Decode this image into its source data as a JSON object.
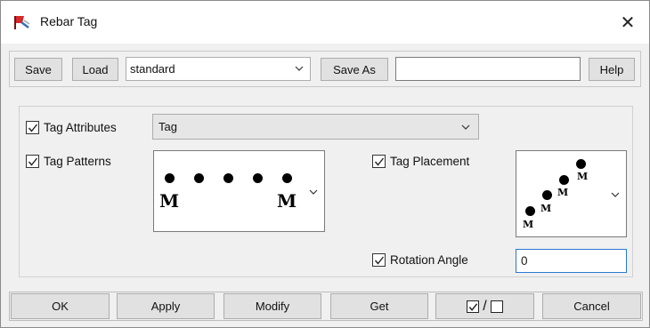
{
  "window": {
    "title": "Rebar Tag",
    "close_glyph": "✕",
    "icon": "rebar-tag-app-icon"
  },
  "toolbar": {
    "save_label": "Save",
    "load_label": "Load",
    "preset_value": "standard",
    "save_as_label": "Save As",
    "save_as_value": "",
    "help_label": "Help"
  },
  "tag_attributes": {
    "label": "Tag Attributes",
    "checked": true,
    "value": "Tag"
  },
  "tag_patterns": {
    "label": "Tag Patterns",
    "checked": true,
    "marker": "M"
  },
  "tag_placement": {
    "label": "Tag Placement",
    "checked": true,
    "marker": "M"
  },
  "rotation_angle": {
    "label": "Rotation Angle",
    "checked": true,
    "value": "0"
  },
  "buttons": {
    "ok": "OK",
    "apply": "Apply",
    "modify": "Modify",
    "get": "Get",
    "toggle_separator": "/",
    "cancel": "Cancel"
  }
}
